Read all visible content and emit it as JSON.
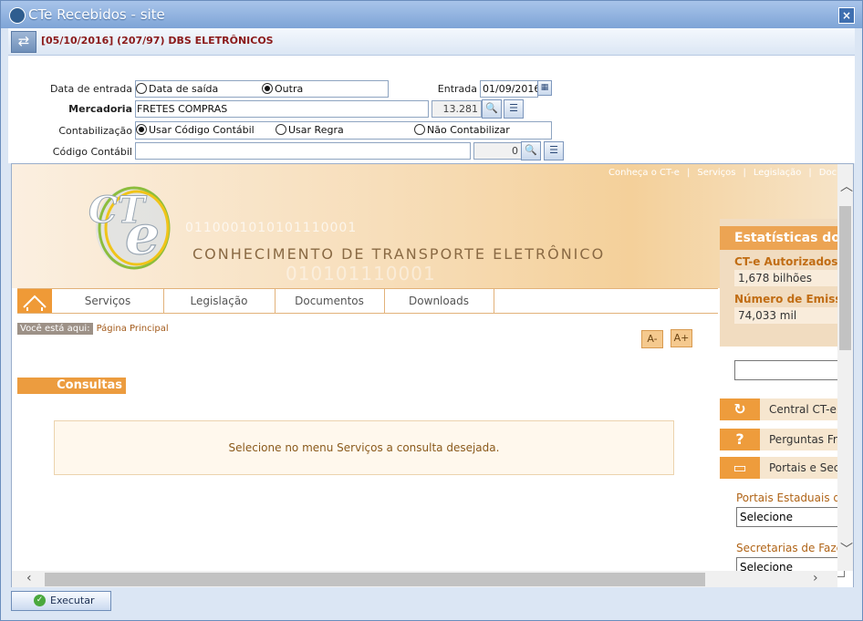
{
  "window": {
    "title": "CTe Recebidos - site",
    "close_glyph": "×"
  },
  "toolbar": {
    "heading": "[05/10/2016] (207/97) DBS ELETRÔNICOS"
  },
  "form": {
    "data_entrada_label": "Data de entrada",
    "opt_data_saida": "Data de saída",
    "opt_outra": "Outra",
    "entrada_label": "Entrada",
    "entrada_value": "01/09/2016",
    "mercadoria_label": "Mercadoria",
    "mercadoria_value": "FRETES COMPRAS",
    "mercadoria_code": "13.281",
    "contabilizacao_label": "Contabilização",
    "opt_usar_codigo": "Usar Código Contábil",
    "opt_usar_regra": "Usar Regra",
    "opt_nao_contabilizar": "Não Contabilizar",
    "codigo_contabil_label": "Código Contábil",
    "codigo_contabil_value": "",
    "codigo_contabil_code": "0"
  },
  "site": {
    "top_links": [
      "Conheça o CT-e",
      "|",
      "Serviços",
      "|",
      "Legislação",
      "|",
      "Docu"
    ],
    "logo_text": "CT-e",
    "subtitle": "CONHECIMENTO DE TRANSPORTE ELETRÔNICO",
    "binary_a": "0110001010101110001",
    "binary_b": "010101110001",
    "nav": [
      "Serviços",
      "Legislação",
      "Documentos",
      "Downloads"
    ],
    "crumb_label": "Você está aqui:",
    "crumb_value": "Página Principal",
    "font_minus": "A-",
    "font_plus": "A+",
    "section_title": "Consultas",
    "message": "Selecione no menu Serviços a consulta desejada.",
    "stats_title": "Estatísticas do C",
    "stat1_label": "CT-e Autorizados",
    "stat1_value": "1,678 bilhões",
    "stat2_label": "Número de Emissor",
    "stat2_value": "74,033 mil",
    "links": [
      "Central CT-e",
      "Perguntas Fr",
      "Portais e Sec"
    ],
    "portais_label": "Portais Estaduais do",
    "portais_value": "Selecione",
    "secretarias_label": "Secretarias de Fazen",
    "secretarias_value": "Selecione"
  },
  "footer": {
    "execute_label": "Executar"
  },
  "colors": {
    "accent_orange": "#ec9c3f",
    "title_blue": "#7ea4d6",
    "heading_red": "#8b1a1a"
  },
  "icons": [
    "app-icon",
    "close-icon",
    "back-forward-icon",
    "calendar-icon",
    "search-icon",
    "list-icon",
    "home-icon",
    "refresh-icon",
    "question-icon",
    "window-icon",
    "check-icon"
  ]
}
